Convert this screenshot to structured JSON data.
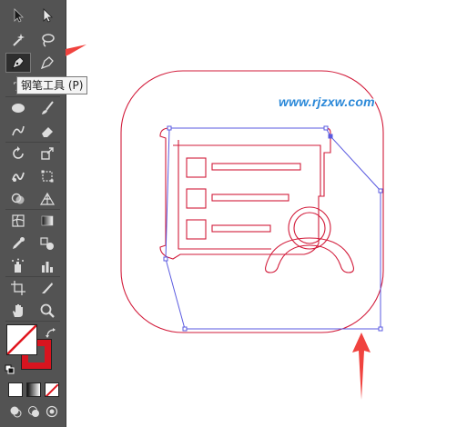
{
  "toolbar": {
    "active_tool": "pen-tool",
    "tooltip": "钢笔工具 (P)"
  },
  "canvas": {
    "watermark": "www.rjzxw.com"
  },
  "colors": {
    "ui_dark": "#535353",
    "artwork_stroke": "#d21b3a",
    "path_selection": "#5a5ae0",
    "annotation_arrow": "#f0433f",
    "watermark": "#2a88d8",
    "stroke_swatch": "#d8141f"
  },
  "icons": [
    "selection-icon",
    "direct-selection-icon",
    "magic-wand-icon",
    "lasso-icon",
    "pen-icon",
    "curvature-icon",
    "type-icon",
    "line-segment-icon",
    "ellipse-icon",
    "paintbrush-icon",
    "shaper-icon",
    "eraser-icon",
    "rotate-icon",
    "scale-icon",
    "warp-icon",
    "free-transform-icon",
    "shape-builder-icon",
    "perspective-grid-icon",
    "mesh-icon",
    "gradient-icon",
    "eyedropper-icon",
    "blend-icon",
    "symbol-sprayer-icon",
    "column-graph-icon",
    "artboard-icon",
    "slice-icon",
    "hand-icon",
    "zoom-icon"
  ]
}
